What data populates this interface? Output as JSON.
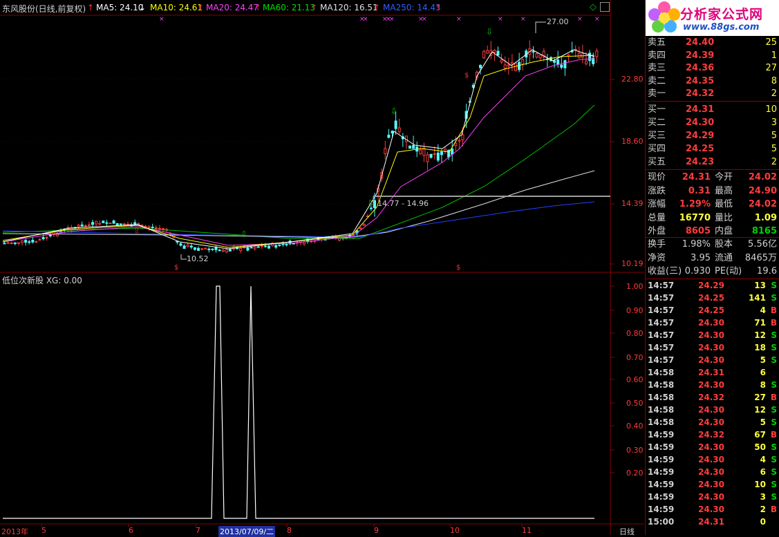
{
  "header": {
    "stock": "东风股份(日线,前复权)",
    "ma": [
      {
        "label": "MA5: 24.10",
        "arrow": "↓",
        "color": "#ffffff",
        "arrowColor": "#ffffff"
      },
      {
        "label": "MA10: 24.61",
        "arrow": "↑",
        "color": "#ffff00",
        "arrowColor": "#ff3030"
      },
      {
        "label": "MA20: 24.47",
        "arrow": "↑",
        "color": "#ff40ff",
        "arrowColor": "#ff3030"
      },
      {
        "label": "MA60: 21.13",
        "arrow": "↑",
        "color": "#00e000",
        "arrowColor": "#ff3030"
      },
      {
        "label": "MA120: 16.51",
        "arrow": "↑",
        "color": "#e0e0e0",
        "arrowColor": "#ff3030"
      },
      {
        "label": "MA250: 14.43",
        "arrow": "↑",
        "color": "#3060ff",
        "arrowColor": "#ff3030"
      }
    ]
  },
  "annotations": {
    "high": "27.00",
    "low": "10.52",
    "range": "14.77 - 14.96"
  },
  "price_axis": [
    "22.80",
    "18.60",
    "14.39",
    "10.19"
  ],
  "indicator": {
    "title": "低位次新股  XG: 0.00",
    "axis": [
      "1.00",
      "0.90",
      "0.80",
      "0.70",
      "0.60",
      "0.50",
      "0.40",
      "0.30",
      "0.20"
    ]
  },
  "x_axis": {
    "labels": [
      "2013年",
      "5",
      "6",
      "7",
      "8",
      "9",
      "10",
      "11"
    ],
    "cursor": "2013/07/09/二",
    "period": "日线"
  },
  "logo": {
    "title": "分析家公式网",
    "url": "www.88gs.com"
  },
  "order_book": {
    "asks": [
      {
        "label": "卖五",
        "price": "24.40",
        "vol": "25"
      },
      {
        "label": "卖四",
        "price": "24.39",
        "vol": "1"
      },
      {
        "label": "卖三",
        "price": "24.36",
        "vol": "27"
      },
      {
        "label": "卖二",
        "price": "24.35",
        "vol": "8"
      },
      {
        "label": "卖一",
        "price": "24.32",
        "vol": "2"
      }
    ],
    "bids": [
      {
        "label": "买一",
        "price": "24.31",
        "vol": "10"
      },
      {
        "label": "买二",
        "price": "24.30",
        "vol": "3"
      },
      {
        "label": "买三",
        "price": "24.29",
        "vol": "5"
      },
      {
        "label": "买四",
        "price": "24.25",
        "vol": "5"
      },
      {
        "label": "买五",
        "price": "24.23",
        "vol": "2"
      }
    ]
  },
  "quote": [
    {
      "l1": "现价",
      "v1": "24.31",
      "c1": "r",
      "l2": "今开",
      "v2": "24.02",
      "c2": "r"
    },
    {
      "l1": "涨跌",
      "v1": "0.31",
      "c1": "r",
      "l2": "最高",
      "v2": "24.90",
      "c2": "r"
    },
    {
      "l1": "涨幅",
      "v1": "1.29%",
      "c1": "r",
      "l2": "最低",
      "v2": "24.02",
      "c2": "r"
    },
    {
      "l1": "总量",
      "v1": "16770",
      "c1": "y",
      "l2": "量比",
      "v2": "1.09",
      "c2": "y"
    },
    {
      "l1": "外盘",
      "v1": "8605",
      "c1": "r",
      "l2": "内盘",
      "v2": "8165",
      "c2": "g"
    }
  ],
  "fund": [
    {
      "l1": "换手",
      "v1": "1.98%",
      "l2": "股本",
      "v2": "5.56亿"
    },
    {
      "l1": "净资",
      "v1": "3.95",
      "l2": "流通",
      "v2": "8465万"
    },
    {
      "l1": "收益(三)",
      "v1": "0.930",
      "l2": "PE(动)",
      "v2": "19.6"
    }
  ],
  "trades": [
    {
      "time": "14:57",
      "price": "24.29",
      "vol": "13",
      "side": "S"
    },
    {
      "time": "14:57",
      "price": "24.25",
      "vol": "141",
      "side": "S"
    },
    {
      "time": "14:57",
      "price": "24.25",
      "vol": "4",
      "side": "B"
    },
    {
      "time": "14:57",
      "price": "24.30",
      "vol": "71",
      "side": "B"
    },
    {
      "time": "14:57",
      "price": "24.30",
      "vol": "12",
      "side": "S"
    },
    {
      "time": "14:57",
      "price": "24.30",
      "vol": "18",
      "side": "S"
    },
    {
      "time": "14:57",
      "price": "24.30",
      "vol": "5",
      "side": "S"
    },
    {
      "time": "14:58",
      "price": "24.31",
      "vol": "6",
      "side": ""
    },
    {
      "time": "14:58",
      "price": "24.30",
      "vol": "8",
      "side": "S"
    },
    {
      "time": "14:58",
      "price": "24.32",
      "vol": "27",
      "side": "B"
    },
    {
      "time": "14:58",
      "price": "24.30",
      "vol": "12",
      "side": "S"
    },
    {
      "time": "14:58",
      "price": "24.30",
      "vol": "5",
      "side": "S"
    },
    {
      "time": "14:59",
      "price": "24.32",
      "vol": "67",
      "side": "B"
    },
    {
      "time": "14:59",
      "price": "24.30",
      "vol": "50",
      "side": "S"
    },
    {
      "time": "14:59",
      "price": "24.30",
      "vol": "4",
      "side": "S"
    },
    {
      "time": "14:59",
      "price": "24.30",
      "vol": "6",
      "side": "S"
    },
    {
      "time": "14:59",
      "price": "24.30",
      "vol": "10",
      "side": "S"
    },
    {
      "time": "14:59",
      "price": "24.30",
      "vol": "3",
      "side": "S"
    },
    {
      "time": "14:59",
      "price": "24.30",
      "vol": "2",
      "side": "B"
    },
    {
      "time": "15:00",
      "price": "24.31",
      "vol": "0",
      "side": ""
    }
  ],
  "colors": {
    "up": "#ff3c3c",
    "down": "#54fcfc",
    "frame": "#8a0000"
  }
}
